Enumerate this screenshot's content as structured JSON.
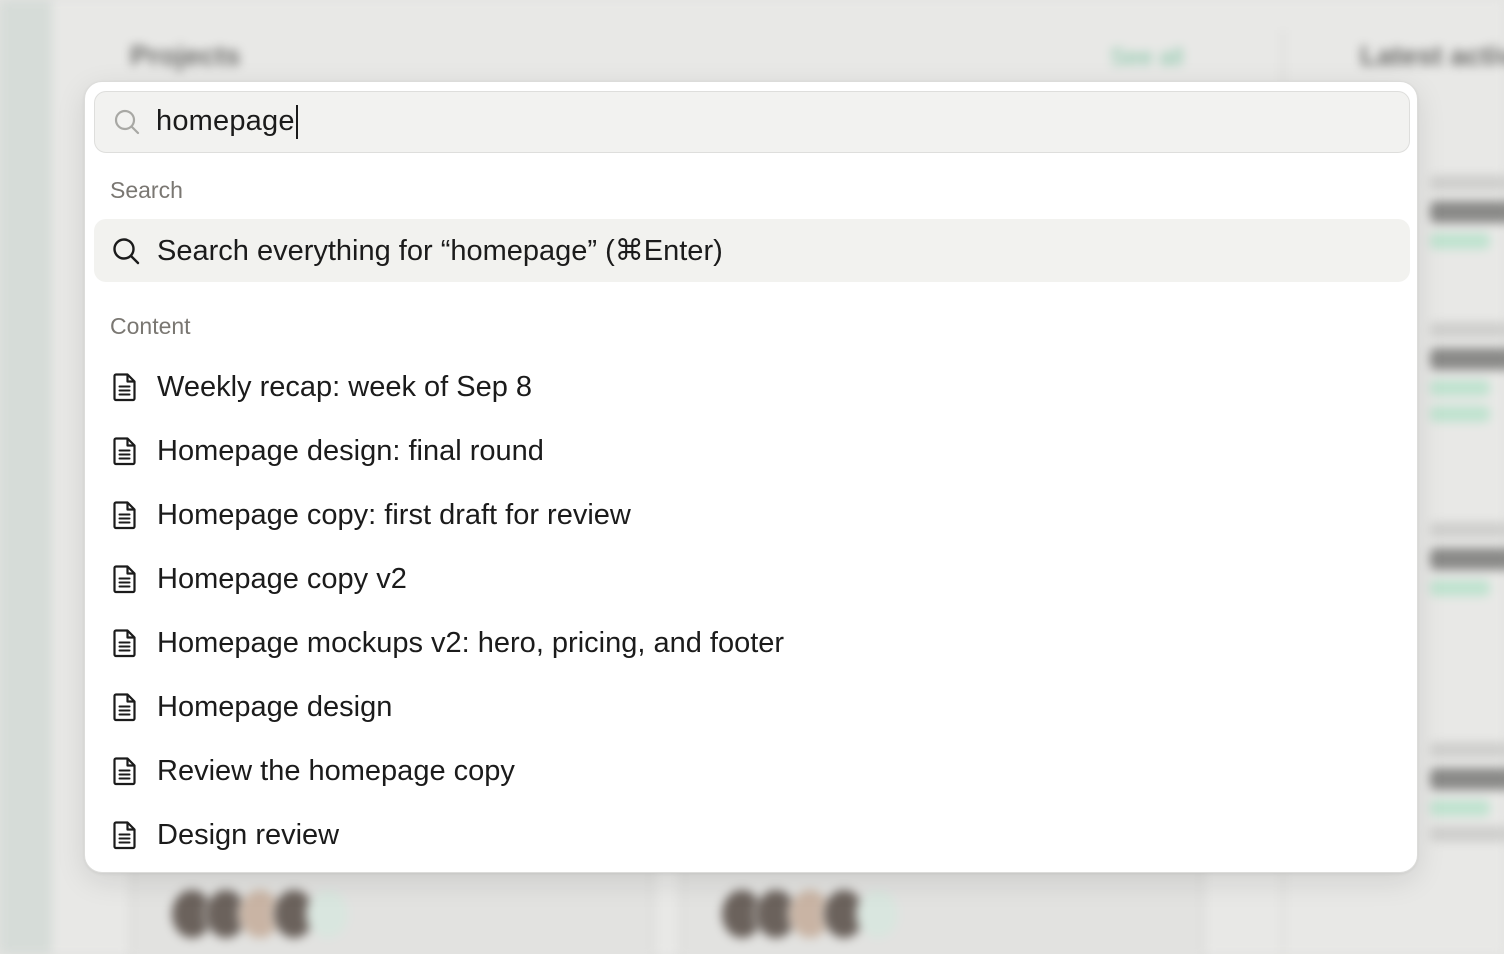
{
  "search": {
    "query": "homepage",
    "icon": "search-icon"
  },
  "sections": {
    "search_label": "Search",
    "content_label": "Content"
  },
  "search_all": {
    "label": "Search everything for “homepage” (⌘Enter)",
    "icon": "search-icon"
  },
  "results": [
    {
      "label": "Weekly recap: week of Sep 8",
      "icon": "document-icon"
    },
    {
      "label": "Homepage design: final round",
      "icon": "document-icon"
    },
    {
      "label": "Homepage copy: first draft for review",
      "icon": "document-icon"
    },
    {
      "label": "Homepage copy v2",
      "icon": "document-icon"
    },
    {
      "label": "Homepage mockups v2: hero, pricing, and footer",
      "icon": "document-icon"
    },
    {
      "label": "Homepage design",
      "icon": "document-icon"
    },
    {
      "label": "Review the homepage copy",
      "icon": "document-icon"
    },
    {
      "label": "Design review",
      "icon": "document-icon"
    }
  ],
  "background": {
    "projects_title": "Projects",
    "see_all": "See all",
    "latest_activity": "Latest activity"
  },
  "colors": {
    "accent_green": "#7fc3a3",
    "highlight": "#f2f2ef",
    "text": "#1b1b1b",
    "muted": "#7a7772"
  }
}
